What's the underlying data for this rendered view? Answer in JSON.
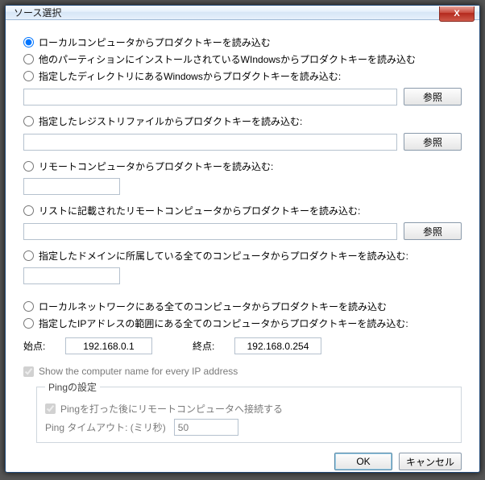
{
  "window": {
    "title": "ソース選択",
    "close": "X"
  },
  "options": {
    "local": "ローカルコンピュータからプロダクトキーを読み込む",
    "other": "他のパーティションにインストールされているWIndowsからプロダクトキーを読み込む",
    "dir": "指定したディレクトリにあるWindowsからプロダクトキーを読み込む:",
    "reg": "指定したレジストリファイルからプロダクトキーを読み込む:",
    "remote": "リモートコンピュータからプロダクトキーを読み込む:",
    "list": "リストに記載されたリモートコンピュータからプロダクトキーを読み込む:",
    "domain": "指定したドメインに所属している全てのコンピュータからプロダクトキーを読み込む:",
    "lan": "ローカルネットワークにある全てのコンピュータからプロダクトキーを読み込む",
    "iprange": "指定したIPアドレスの範囲にある全てのコンピュータからプロダクトキーを読み込む:"
  },
  "buttons": {
    "browse": "参照",
    "ok": "OK",
    "cancel": "キャンセル"
  },
  "ip": {
    "from_label": "始点:",
    "to_label": "終点:",
    "from": "192.168.0.1",
    "to": "192.168.0.254"
  },
  "show_name": "Show the computer name for every IP address",
  "ping": {
    "legend": "Pingの設定",
    "connect": "Pingを打った後にリモートコンピュータへ接続する",
    "timeout_label": "Ping タイムアウト: (ミリ秒)",
    "timeout": "50"
  }
}
